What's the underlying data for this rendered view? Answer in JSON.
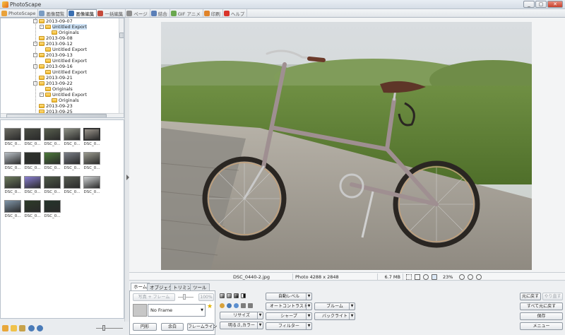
{
  "app": {
    "title": "PhotoScape",
    "window_buttons": [
      "_",
      "▢",
      "✕"
    ]
  },
  "tabs": [
    {
      "label": "PhotoScape",
      "icon": "photoscape-icon",
      "color": "#e9a23b"
    },
    {
      "label": "画像閲覧",
      "icon": "viewer-icon",
      "color": "#7a9cc2"
    },
    {
      "label": "画像編集",
      "icon": "editor-icon",
      "color": "#3b6fb1",
      "active": true
    },
    {
      "label": "一括編集",
      "icon": "batch-icon",
      "color": "#c44a3b"
    },
    {
      "label": "ページ",
      "icon": "page-icon",
      "color": "#8e8e8e"
    },
    {
      "label": "結合",
      "icon": "combine-icon",
      "color": "#5a7fb8"
    },
    {
      "label": "GIF アニメ",
      "icon": "gif-icon",
      "color": "#6aa84f"
    },
    {
      "label": "印刷",
      "icon": "print-icon",
      "color": "#e0842b"
    },
    {
      "label": "ヘルプ",
      "icon": "help-icon",
      "color": "#d9342b"
    }
  ],
  "tree": [
    {
      "label": "2013-09-07",
      "level": 0,
      "toggle": "-"
    },
    {
      "label": "Untitled Export",
      "level": 1,
      "toggle": "-",
      "selected": true
    },
    {
      "label": "Originals",
      "level": 2,
      "toggle": ""
    },
    {
      "label": "2013-09-08",
      "level": 0,
      "toggle": ""
    },
    {
      "label": "2013-09-12",
      "level": 0,
      "toggle": "-"
    },
    {
      "label": "Untitled Export",
      "level": 1,
      "toggle": ""
    },
    {
      "label": "2013-09-13",
      "level": 0,
      "toggle": "-"
    },
    {
      "label": "Untitled Export",
      "level": 1,
      "toggle": ""
    },
    {
      "label": "2013-09-16",
      "level": 0,
      "toggle": "-"
    },
    {
      "label": "Untitled Export",
      "level": 1,
      "toggle": ""
    },
    {
      "label": "2013-09-21",
      "level": 0,
      "toggle": ""
    },
    {
      "label": "2013-09-22",
      "level": 0,
      "toggle": "-"
    },
    {
      "label": "Originals",
      "level": 1,
      "toggle": ""
    },
    {
      "label": "Untitled Export",
      "level": 1,
      "toggle": "-"
    },
    {
      "label": "Originals",
      "level": 2,
      "toggle": ""
    },
    {
      "label": "2013-09-23",
      "level": 0,
      "toggle": ""
    },
    {
      "label": "2013-09-25",
      "level": 0,
      "toggle": ""
    }
  ],
  "thumbnails": [
    {
      "label": "DSC_0...",
      "color": "#6b6b62",
      "selected": false
    },
    {
      "label": "DSC_0...",
      "color": "#4a4d44",
      "selected": false
    },
    {
      "label": "DSC_0...",
      "color": "#59604f",
      "selected": false
    },
    {
      "label": "DSC_0...",
      "color": "#8d9084",
      "selected": false
    },
    {
      "label": "DSC_0...",
      "color": "#9b958c",
      "selected": true
    },
    {
      "label": "DSC_0...",
      "color": "#b9c0c6",
      "selected": false
    },
    {
      "label": "DSC_0...",
      "color": "#2f332c",
      "selected": false
    },
    {
      "label": "DSC_0...",
      "color": "#4c7a3a",
      "selected": false
    },
    {
      "label": "DSC_0...",
      "color": "#7b7f87",
      "selected": false
    },
    {
      "label": "DSC_0...",
      "color": "#9a9a8e",
      "selected": false
    },
    {
      "label": "DSC_0...",
      "color": "#6d7b5d",
      "selected": false
    },
    {
      "label": "DSC_0...",
      "color": "#8a7fd1",
      "selected": false
    },
    {
      "label": "DSC_0...",
      "color": "#4f5a48",
      "selected": false
    },
    {
      "label": "DSC_0...",
      "color": "#575c52",
      "selected": false
    },
    {
      "label": "DSC_0...",
      "color": "#d0d3d4",
      "selected": false
    },
    {
      "label": "DSC_0...",
      "color": "#8095a8",
      "selected": false
    },
    {
      "label": "DSC_0...",
      "color": "#2d3b28",
      "selected": false
    },
    {
      "label": "DSC_0...",
      "color": "#24342a",
      "selected": false
    }
  ],
  "status": {
    "filename": "DSC_0440-2.jpg",
    "dimensions": "Photo 4288 x 2848",
    "filesize": "6.7 MB",
    "zoom": "23%"
  },
  "edit_tabs": [
    {
      "label": "ホーム",
      "active": true
    },
    {
      "label": "オブジェクト",
      "active": false
    },
    {
      "label": "トリミング",
      "active": false
    },
    {
      "label": "ツール",
      "active": false
    }
  ],
  "frame": {
    "photo_frame_button": "写真 + フレーム",
    "opacity": "100%",
    "selected_frame": "No Frame",
    "round_button": "円形",
    "margin_button": "余白",
    "frame_line_button": "フレームライン"
  },
  "adjust": {
    "auto_level": "自動レベル",
    "auto_contrast": "オートコントラスト",
    "sharpen": "シャープ",
    "filter": "フィルター",
    "bloom": "ブルーム",
    "backlight": "バックライト",
    "resize": "リサイズ",
    "brightness_color": "明るさ,カラー"
  },
  "right_actions": {
    "undo": "元に戻す",
    "redo": "やり直す",
    "undo_all": "すべて元に戻す",
    "save": "保存",
    "menu": "メニュー"
  }
}
